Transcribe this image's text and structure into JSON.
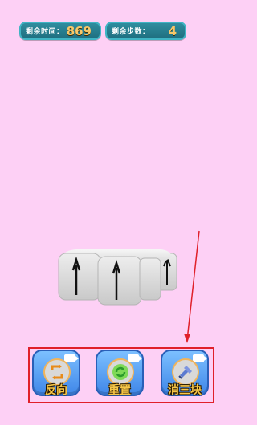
{
  "hud": {
    "time_label": "剩余时间：",
    "time_value": "869",
    "steps_label": "剩余步数：",
    "steps_value": "4"
  },
  "tools": {
    "reverse_label": "反向",
    "reset_label": "重置",
    "clear_label": "消三块"
  },
  "colors": {
    "background": "#fdd0f5",
    "hud": "#2f8d9e",
    "button": "#4b92f0",
    "highlight_frame": "#e0202a"
  }
}
